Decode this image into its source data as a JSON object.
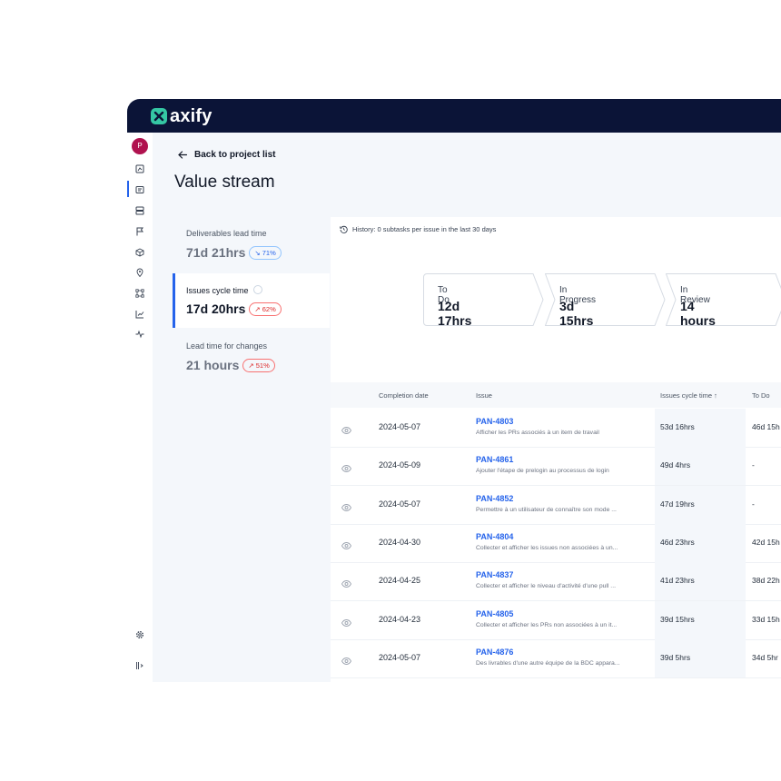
{
  "brand": {
    "name": "axify"
  },
  "user": {
    "initial": "P"
  },
  "sidebar": {
    "icons": [
      "dashboard-icon",
      "value-stream-icon",
      "layers-icon",
      "flag-icon",
      "cube-icon",
      "location-icon",
      "workflow-icon",
      "chart-icon",
      "pulse-icon"
    ],
    "bottom_icons": [
      "settings-icon",
      "collapse-icon"
    ]
  },
  "header": {
    "back_label": "Back to project list",
    "title": "Value stream"
  },
  "metrics": [
    {
      "label": "Deliverables lead time",
      "value": "71d 21hrs",
      "delta": "↘ 71%",
      "trend": "down"
    },
    {
      "label": "Issues cycle time",
      "value": "17d 20hrs",
      "delta": "↗ 62%",
      "trend": "up"
    },
    {
      "label": "Lead time for changes",
      "value": "21 hours",
      "delta": "↗ 51%",
      "trend": "up"
    }
  ],
  "history": {
    "text": "History: 0 subtasks per issue in the last 30 days"
  },
  "stages": [
    {
      "label": "To Do",
      "value": "12d 17hrs"
    },
    {
      "label": "In Progress",
      "value": "3d 15hrs"
    },
    {
      "label": "In Review",
      "value": "14 hours"
    }
  ],
  "table": {
    "headers": {
      "completion": "Completion date",
      "issue": "Issue",
      "cycle": "Issues cycle time ↑",
      "todo": "To Do"
    },
    "rows": [
      {
        "date": "2024-05-07",
        "id": "PAN-4803",
        "desc": "Afficher les PRs associés à un item de travail",
        "cycle": "53d 16hrs",
        "todo": "46d 15h"
      },
      {
        "date": "2024-05-09",
        "id": "PAN-4861",
        "desc": "Ajouter l'étape de prelogin au processus de login",
        "cycle": "49d 4hrs",
        "todo": "-"
      },
      {
        "date": "2024-05-07",
        "id": "PAN-4852",
        "desc": "Permettre à un utilisateur de connaître son mode ...",
        "cycle": "47d 19hrs",
        "todo": "-"
      },
      {
        "date": "2024-04-30",
        "id": "PAN-4804",
        "desc": "Collecter et afficher les issues non associées à un...",
        "cycle": "46d 23hrs",
        "todo": "42d 15h"
      },
      {
        "date": "2024-04-25",
        "id": "PAN-4837",
        "desc": "Collecter et afficher le niveau d'activité d'une pull ...",
        "cycle": "41d 23hrs",
        "todo": "38d 22h"
      },
      {
        "date": "2024-04-23",
        "id": "PAN-4805",
        "desc": "Collecter et afficher les PRs non associées à un it...",
        "cycle": "39d 15hrs",
        "todo": "33d 15h"
      },
      {
        "date": "2024-05-07",
        "id": "PAN-4876",
        "desc": "Des livrables d'une autre équipe de la BDC appara...",
        "cycle": "39d 5hrs",
        "todo": "34d 5hr"
      }
    ]
  },
  "colors": {
    "topbar": "#0b1437",
    "accent": "#2563eb",
    "brand": "#35c7a4",
    "avatar": "#b0124f"
  }
}
